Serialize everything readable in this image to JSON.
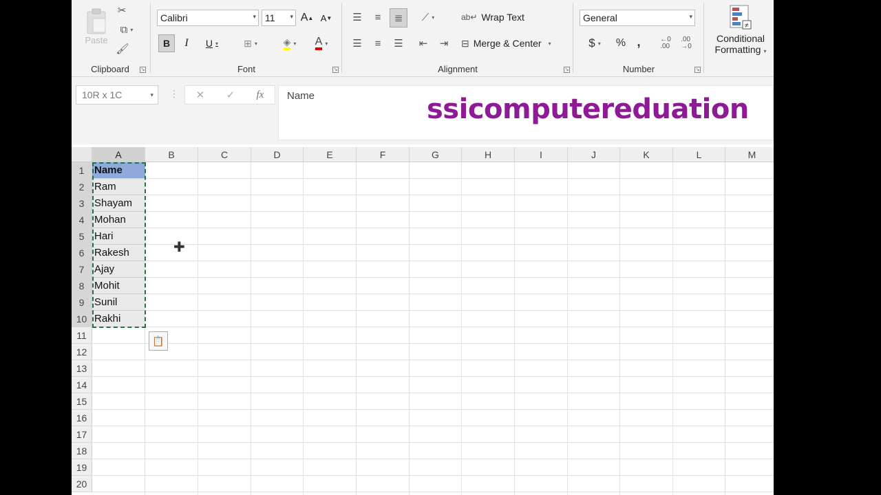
{
  "ribbon": {
    "clipboard": {
      "label": "Clipboard",
      "paste_label": "Paste"
    },
    "font": {
      "label": "Font",
      "font_name": "Calibri",
      "font_size": "11",
      "bold": "B",
      "italic": "I",
      "underline": "U",
      "grow": "A",
      "shrink": "A"
    },
    "alignment": {
      "label": "Alignment",
      "wrap_text": "Wrap Text",
      "merge_center": "Merge & Center"
    },
    "number": {
      "label": "Number",
      "format": "General",
      "currency": "$",
      "percent": "%",
      "comma": ","
    },
    "styles": {
      "conditional_formatting_line1": "Conditional",
      "conditional_formatting_line2": "Formatting"
    }
  },
  "formula_bar": {
    "name_box": "10R x 1C",
    "formula": "Name"
  },
  "watermark": "ssicomputereduation",
  "grid": {
    "columns": [
      "A",
      "B",
      "C",
      "D",
      "E",
      "F",
      "G",
      "H",
      "I",
      "J",
      "K",
      "L",
      "M"
    ],
    "rows": [
      "1",
      "2",
      "3",
      "4",
      "5",
      "6",
      "7",
      "8",
      "9",
      "10",
      "11",
      "12",
      "13",
      "14",
      "15",
      "16",
      "17",
      "18",
      "19",
      "20"
    ],
    "column_a": [
      "Name",
      "Ram",
      "Shayam",
      "Mohan",
      "Hari",
      "Rakesh",
      "Ajay",
      "Mohit",
      "Sunil",
      "Rakhi"
    ]
  },
  "colors": {
    "header_fill": "#8eaadb",
    "selection_fill": "#e9e9e9",
    "marquee": "#217346",
    "watermark": "#8e1a96"
  }
}
